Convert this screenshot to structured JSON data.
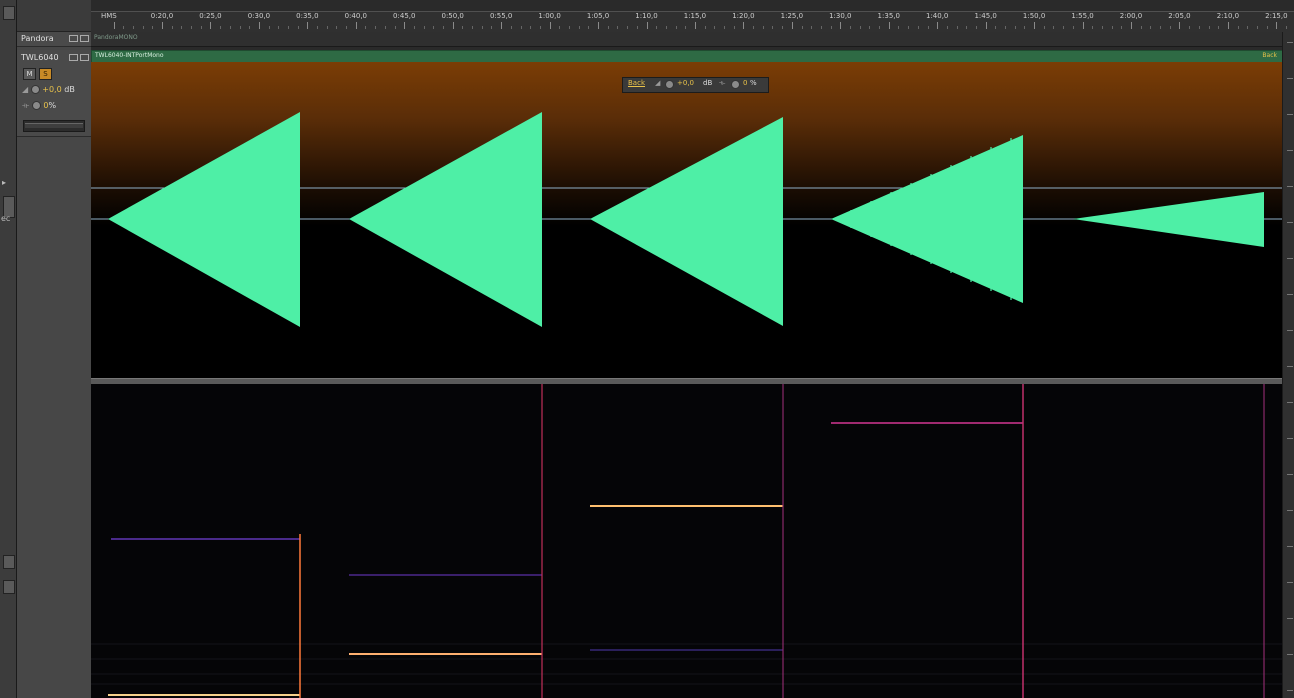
{
  "ruler": {
    "time_format": "HMS",
    "labels": [
      "0:20,0",
      "0:25,0",
      "0:30,0",
      "0:35,0",
      "0:40,0",
      "0:45,0",
      "0:50,0",
      "0:55,0",
      "1:00,0",
      "1:05,0",
      "1:10,0",
      "1:15,0",
      "1:20,0",
      "1:25,0",
      "1:30,0",
      "1:35,0",
      "1:40,0",
      "1:45,0",
      "1:50,0",
      "1:55,0",
      "2:00,0",
      "2:05,0",
      "2:10,0",
      "2:15,0"
    ]
  },
  "tracks": [
    {
      "name": "Pandora",
      "clip_name": "PandoraMONO"
    },
    {
      "name": "TWL6040",
      "clip_name": "TWL6040-INTPortMono",
      "clip_tag": "Back",
      "mute_label": "M",
      "solo_label": "S",
      "volume": "+0,0",
      "volume_unit": "dB",
      "pan": "0",
      "pan_unit": "%"
    }
  ],
  "hud": {
    "routing": "Back",
    "volume": "+0,0",
    "volume_unit": "dB",
    "pan": "0",
    "pan_unit": "%"
  },
  "colors": {
    "waveform": "#4eefa6",
    "clip_bar": "#2e6a44",
    "accent": "#e8c24a"
  }
}
